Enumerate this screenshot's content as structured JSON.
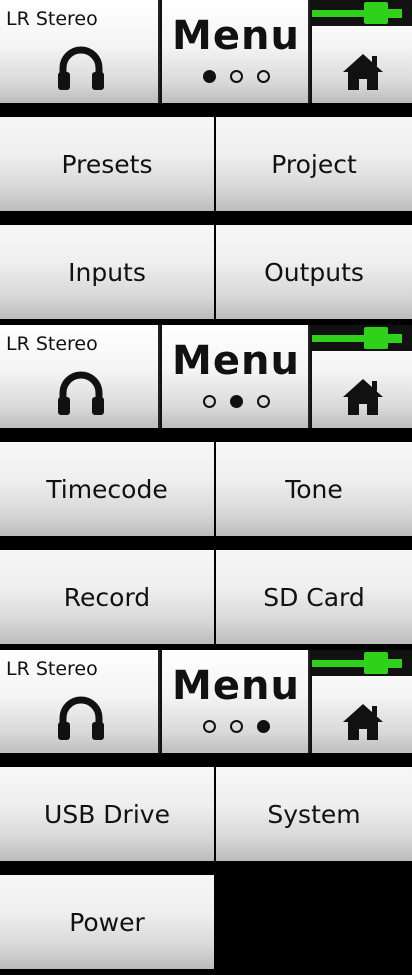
{
  "colors": {
    "background": "#000000",
    "button_light": "#f7f7f7",
    "button_shadow": "#bcbcbc",
    "meter_green": "#2fd11a",
    "text": "#111111"
  },
  "screens": [
    {
      "monitor_label": "LR Stereo",
      "monitor_icon": "headphones-icon",
      "menu_title": "Menu",
      "active_page": 1,
      "page_count": 3,
      "home_icon": "home-icon",
      "buttons": [
        {
          "label": "Presets"
        },
        {
          "label": "Project"
        },
        {
          "label": "Inputs"
        },
        {
          "label": "Outputs"
        }
      ]
    },
    {
      "monitor_label": "LR Stereo",
      "monitor_icon": "headphones-icon",
      "menu_title": "Menu",
      "active_page": 2,
      "page_count": 3,
      "home_icon": "home-icon",
      "buttons": [
        {
          "label": "Timecode"
        },
        {
          "label": "Tone"
        },
        {
          "label": "Record"
        },
        {
          "label": "SD Card"
        }
      ]
    },
    {
      "monitor_label": "LR Stereo",
      "monitor_icon": "headphones-icon",
      "menu_title": "Menu",
      "active_page": 3,
      "page_count": 3,
      "home_icon": "home-icon",
      "buttons": [
        {
          "label": "USB Drive"
        },
        {
          "label": "System"
        },
        {
          "label": "Power"
        }
      ]
    }
  ]
}
